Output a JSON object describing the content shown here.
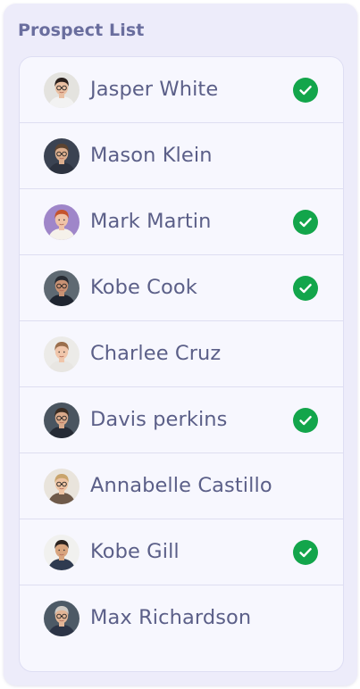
{
  "panel": {
    "title": "Prospect List"
  },
  "prospects": [
    {
      "name": "Jasper White",
      "checked": true,
      "avatar": {
        "bg": "#e4e3df",
        "skin": "#e9bfa2",
        "hair": "#2a201d",
        "shirt": "#f2f2f2",
        "glasses": true
      }
    },
    {
      "name": "Mason Klein",
      "checked": false,
      "avatar": {
        "bg": "#3b4352",
        "skin": "#dcae8e",
        "hair": "#5c4330",
        "shirt": "#2d3340",
        "glasses": true
      }
    },
    {
      "name": "Mark Martin",
      "checked": true,
      "avatar": {
        "bg": "#9f86c9",
        "skin": "#efc3a8",
        "hair": "#c5542e",
        "shirt": "#f5f1ea",
        "glasses": false
      }
    },
    {
      "name": "Kobe Cook",
      "checked": true,
      "avatar": {
        "bg": "#5e6972",
        "skin": "#c99274",
        "hair": "#272b33",
        "shirt": "#1f2530",
        "glasses": true
      }
    },
    {
      "name": "Charlee Cruz",
      "checked": false,
      "avatar": {
        "bg": "#ecebe8",
        "skin": "#f0c6ab",
        "hair": "#9a6e4c",
        "shirt": "#e8e6e2",
        "glasses": false
      }
    },
    {
      "name": "Davis perkins",
      "checked": true,
      "avatar": {
        "bg": "#4a5560",
        "skin": "#d9a98a",
        "hair": "#3a2c22",
        "shirt": "#262b35",
        "glasses": true
      }
    },
    {
      "name": "Annabelle Castillo",
      "checked": false,
      "avatar": {
        "bg": "#e9e4dc",
        "skin": "#eec4a4",
        "hair": "#c9a46c",
        "shirt": "#6f5a4a",
        "glasses": true
      }
    },
    {
      "name": "Kobe Gill",
      "checked": true,
      "avatar": {
        "bg": "#f1f1ef",
        "skin": "#d8a57f",
        "hair": "#2b2320",
        "shirt": "#2f3b50",
        "glasses": false
      }
    },
    {
      "name": "Max Richardson",
      "checked": false,
      "avatar": {
        "bg": "#4d5a66",
        "skin": "#e2b596",
        "hair": "#cfcac4",
        "shirt": "#2c3446",
        "glasses": true
      }
    }
  ],
  "colors": {
    "panel_bg": "#edecfa",
    "list_bg": "#f7f7fe",
    "title": "#6a6e9e",
    "name_text": "#5b5f88",
    "check_green": "#13a54b"
  },
  "icons": {
    "checked": "check-circle-icon"
  }
}
